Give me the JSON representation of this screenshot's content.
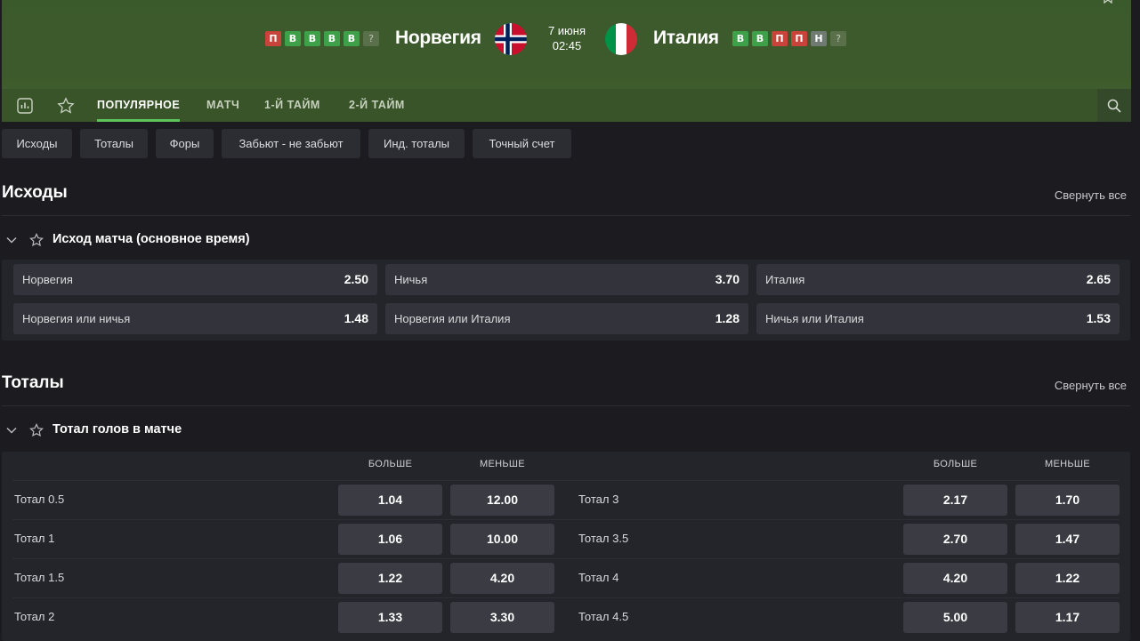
{
  "match": {
    "home": {
      "name": "Норвегия",
      "form": [
        "П",
        "В",
        "В",
        "В",
        "В",
        "?"
      ]
    },
    "away": {
      "name": "Италия",
      "form": [
        "В",
        "В",
        "П",
        "П",
        "Н",
        "?"
      ]
    },
    "date": "7 июня",
    "time": "02:45"
  },
  "tabs": [
    "ПОПУЛЯРНОЕ",
    "МАТЧ",
    "1-Й ТАЙМ",
    "2-Й ТАЙМ"
  ],
  "chips": [
    "Исходы",
    "Тоталы",
    "Форы",
    "Забьют - не забьют",
    "Инд. тоталы",
    "Точный счет"
  ],
  "sections": {
    "outcomes": {
      "title": "Исходы",
      "collapse": "Свернуть все",
      "market": "Исход матча (основное время)",
      "odds": [
        {
          "label": "Норвегия",
          "value": "2.50"
        },
        {
          "label": "Ничья",
          "value": "3.70"
        },
        {
          "label": "Италия",
          "value": "2.65"
        },
        {
          "label": "Норвегия или ничья",
          "value": "1.48"
        },
        {
          "label": "Норвегия или Италия",
          "value": "1.28"
        },
        {
          "label": "Ничья или Италия",
          "value": "1.53"
        }
      ]
    },
    "totals": {
      "title": "Тоталы",
      "collapse": "Свернуть все",
      "market": "Тотал голов в матче",
      "over": "БОЛЬШЕ",
      "under": "МЕНЬШЕ",
      "left": [
        {
          "label": "Тотал 0.5",
          "over": "1.04",
          "under": "12.00"
        },
        {
          "label": "Тотал 1",
          "over": "1.06",
          "under": "10.00"
        },
        {
          "label": "Тотал 1.5",
          "over": "1.22",
          "under": "4.20"
        },
        {
          "label": "Тотал 2",
          "over": "1.33",
          "under": "3.30"
        }
      ],
      "right": [
        {
          "label": "Тотал 3",
          "over": "2.17",
          "under": "1.70"
        },
        {
          "label": "Тотал 3.5",
          "over": "2.70",
          "under": "1.47"
        },
        {
          "label": "Тотал 4",
          "over": "4.20",
          "under": "1.22"
        },
        {
          "label": "Тотал 4.5",
          "over": "5.00",
          "under": "1.17"
        }
      ]
    }
  },
  "colors": {
    "win": "#3fa04a",
    "loss": "#c8443a",
    "draw": "#6f7a72",
    "accent": "#5cc45a"
  },
  "icons": [
    "stats-icon",
    "star-icon",
    "search-icon",
    "chevron-down-icon",
    "pin-icon"
  ]
}
